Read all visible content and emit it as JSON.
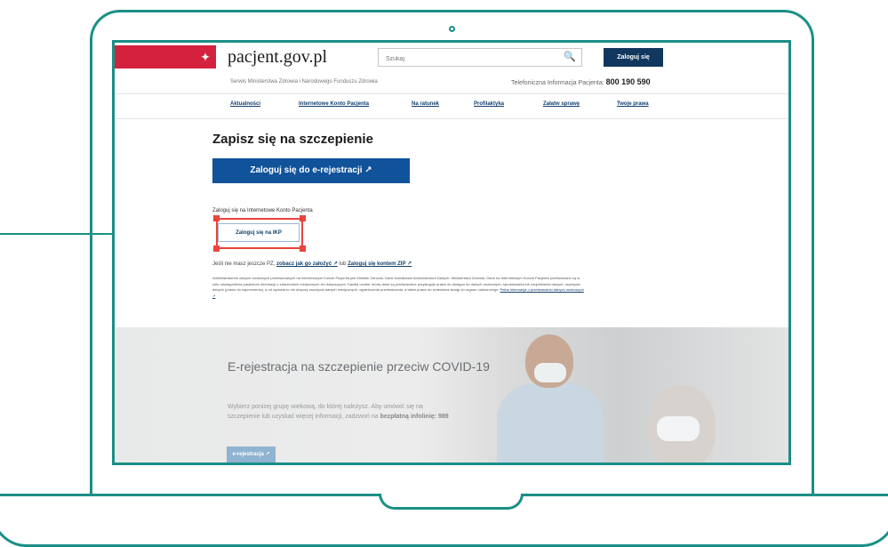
{
  "colors": {
    "frame": "#1a8f86",
    "brand_red": "#d4213d",
    "primary_blue": "#11539a",
    "dark_navy": "#11375e",
    "highlight": "#e8453c"
  },
  "header": {
    "emblem_icon": "polish-eagle-icon",
    "site_title": "pacjent.gov.pl",
    "search_placeholder": "Szukaj",
    "search_icon_glyph": "🔍",
    "login_label": "Zaloguj się",
    "subtitle": "Serwis Ministerstwa Zdrowia i Narodowego Funduszu Zdrowia",
    "phone_label": "Telefoniczna Informacja Pacjenta:",
    "phone_number": "800 190 590"
  },
  "nav": {
    "items": [
      {
        "label": "Aktualności"
      },
      {
        "label": "Internetowe Konto Pacjenta"
      },
      {
        "label": "Na ratunek"
      },
      {
        "label": "Profilaktyka"
      },
      {
        "label": "Załatw sprawę"
      },
      {
        "label": "Twoje prawa"
      }
    ]
  },
  "main": {
    "title": "Zapisz się na szczepienie",
    "erej_button": "Zaloguj się do e-rejestracji ↗",
    "ikp_label": "Zaloguj się na Internetowe Konto Pacjenta",
    "ikp_button": "Zaloguj się na IKP",
    "account_prefix": "Jeśli nie masz jeszcze PZ,",
    "account_link1": "zobacz jak go założyć ↗",
    "account_mid": "lub",
    "account_link2": "Zaloguj się kontem ZIP ↗",
    "privacy_text": "Administratorem danych osobowych przetwarzanych na Internetowym Koncie Pacjenta jest Minister Zdrowia. Dane kontaktowe Administratora Danych: Ministerstwo Zdrowia. Dane na Internetowym Koncie Pacjenta przetwarzane są w celu udostępnienia pacjentom informacji o zdarzeniach medycznych ich dotyczących. Każdej osobie, której dane są przetwarzane przysługuje prawo do dostępu do danych osobowych, sprostowania lub uzupełnienia danych, usunięcia danych (prawo do zapomnienia), a od żądania to nie dotyczy usunięcia danych medycznych, ograniczenia przetwarzania, a także prawo do wniesienia skargi do organu nadzorczego.",
    "privacy_link": "Pełna informacja o przetwarzaniu danych osobowych ↗"
  },
  "banner": {
    "title": "E-rejestracja na szczepienie przeciw COVID-19",
    "text": "Wybierz poniżej grupę wiekową, do której należysz. Aby umówić się na szczepienie lub uzyskać więcej informacji, zadzwoń na",
    "bold_text": "bezpłatną infolinię:",
    "hotline": "989",
    "button": "e-rejestracja ↗"
  }
}
